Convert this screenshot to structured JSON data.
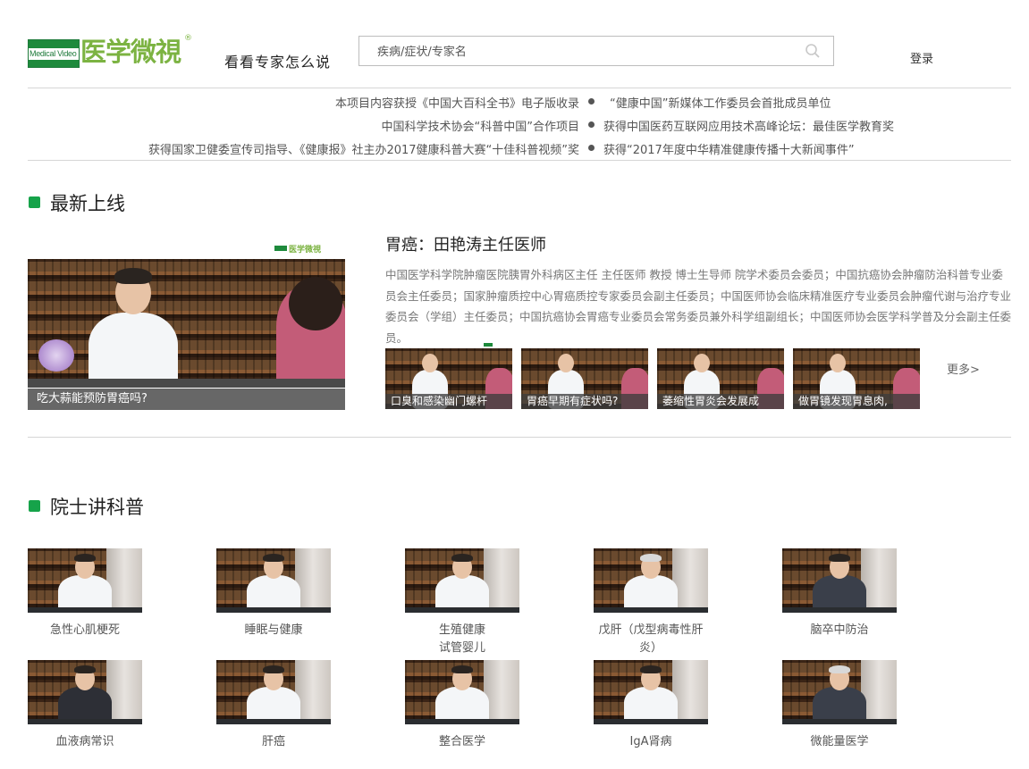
{
  "header": {
    "logo_en": "Medical Video",
    "logo_cn": "医学微視",
    "logo_reg": "®",
    "slogan": "看看专家怎么说",
    "search_placeholder": "疾病/症状/专家名",
    "login_label": "登录"
  },
  "awards": [
    {
      "left": "本项目内容获授《中国大百科全书》电子版收录",
      "right": "“健康中国”新媒体工作委员会首批成员单位"
    },
    {
      "left": "中国科学技术协会“科普中国”合作项目",
      "right": "获得中国医药互联网应用技术高峰论坛：最佳医学教育奖"
    },
    {
      "left": "获得国家卫健委宣传司指导、《健康报》社主办2017健康科普大赛“十佳科普视频”奖",
      "right": "获得“2017年度中华精准健康传播十大新闻事件”"
    }
  ],
  "latest": {
    "heading": "最新上线",
    "featured_caption": "吃大蒜能预防胃癌吗?",
    "doctor_title": "胃癌：田艳涛主任医师",
    "doctor_bio": "中国医学科学院肿瘤医院胰胃外科病区主任 主任医师 教授 博士生导师 院学术委员会委员；中国抗癌协会肿瘤防治科普专业委员会主任委员；国家肿瘤质控中心胃癌质控专家委员会副主任委员；中国医师协会临床精准医疗专业委员会肿瘤代谢与治疗专业委员会（学组）主任委员；中国抗癌协会胃癌专业委员会常务委员兼外科学组副组长；中国医师协会医学科学普及分会副主任委员。",
    "videos": [
      "口臭和感染幽门螺杆",
      "胃癌早期有症状吗?",
      "萎缩性胃炎会发展成",
      "做胃镜发现胃息肉,"
    ],
    "more_label": "更多>"
  },
  "academicians": {
    "heading": "院士讲科普",
    "row1": [
      "急性心肌梗死",
      "睡眠与健康",
      "生殖健康\n试管婴儿",
      "戊肝（戊型病毒性肝炎）",
      "脑卒中防治"
    ],
    "row2": [
      "血液病常识",
      "肝癌",
      "整合医学",
      "IgA肾病",
      "微能量医学"
    ]
  },
  "colors": {
    "accent_green": "#16a34a",
    "logo_green": "#7cb342"
  }
}
